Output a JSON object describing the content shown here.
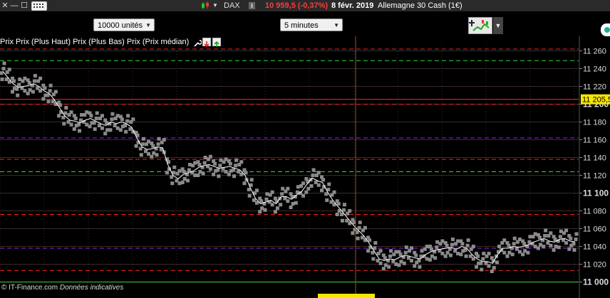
{
  "titlebar": {
    "close_glyph": "✕",
    "minimize_glyph": "—",
    "maximize_glyph": "☐",
    "keyboard_icon": "keyboard-icon",
    "candlestick_icon": "candlestick-icon",
    "symbol": "DAX",
    "info_glyph": "i",
    "price_change": "10 959,5 (-0,37%)",
    "date": "8 févr. 2019",
    "instrument": "Allemagne 30 Cash (1€)"
  },
  "toolbar": {
    "units_value": "10000 unités",
    "interval_value": "5 minutes",
    "indicator_icon": "indicators-icon"
  },
  "legend": {
    "text": "Prix Prix (Plus Haut) Prix (Plus Bas) Prix (Prix médian)",
    "wrench_icon": "wrench-icon",
    "down_icon": "arrow-down-icon",
    "up_icon": "arrow-up-icon"
  },
  "colors": {
    "background": "#000000",
    "grid": "#3a2a2a",
    "price_dots": "#8a8a8a",
    "median_line": "#ffffff",
    "level_red": "#ff2020",
    "level_green": "#3cd43c",
    "level_purple": "#a020f0",
    "current_price_bg": "#f5e600"
  },
  "footer": {
    "copyright": "© IT-Finance.com",
    "disclaimer": "Données indicatives"
  },
  "chart_data": {
    "type": "scatter",
    "y_ticks": [
      "11 260",
      "11 240",
      "11 220",
      "11 200",
      "11 180",
      "11 160",
      "11 140",
      "11 120",
      "11 100",
      "11 080",
      "11 060",
      "11 040",
      "11 020",
      "11 000"
    ],
    "bold_ticks": [
      "11 200",
      "11 100",
      "11 000"
    ],
    "ylim": [
      10998,
      11266
    ],
    "current_price_label": "11 205,5",
    "current_price": 11205.5,
    "horizontal_levels": [
      {
        "y": 11262,
        "color": "red",
        "style": "dashed"
      },
      {
        "y": 11249,
        "color": "green",
        "style": "dashed"
      },
      {
        "y": 11205.5,
        "color": "red",
        "style": "solid"
      },
      {
        "y": 11200,
        "color": "red",
        "style": "dashed"
      },
      {
        "y": 11162,
        "color": "purple",
        "style": "dashed"
      },
      {
        "y": 11138,
        "color": "red",
        "style": "dashed"
      },
      {
        "y": 11124,
        "color": "green",
        "style": "dashed"
      },
      {
        "y": 11076,
        "color": "red",
        "style": "dashed"
      },
      {
        "y": 11038,
        "color": "purple",
        "style": "dashed"
      },
      {
        "y": 11013,
        "color": "red",
        "style": "dashed"
      },
      {
        "y": 11000,
        "color": "green",
        "style": "solid"
      }
    ],
    "median": [
      11237,
      11230,
      11223,
      11219,
      11220,
      11221,
      11223,
      11220,
      11215,
      11212,
      11205,
      11196,
      11187,
      11182,
      11181,
      11179,
      11182,
      11184,
      11181,
      11178,
      11176,
      11180,
      11178,
      11180,
      11178,
      11174,
      11162,
      11152,
      11149,
      11150,
      11152,
      11151,
      11132,
      11120,
      11116,
      11121,
      11123,
      11125,
      11129,
      11131,
      11132,
      11130,
      11128,
      11129,
      11130,
      11128,
      11126,
      11120,
      11106,
      11094,
      11088,
      11090,
      11092,
      11088,
      11096,
      11096,
      11093,
      11098,
      11102,
      11110,
      11117,
      11114,
      11112,
      11101,
      11092,
      11085,
      11078,
      11071,
      11064,
      11058,
      11052,
      11044,
      11035,
      11026,
      11024,
      11026,
      11025,
      11028,
      11030,
      11029,
      11027,
      11026,
      11031,
      11034,
      11036,
      11037,
      11038,
      11039,
      11037,
      11040,
      11038,
      11031,
      11026,
      11023,
      11023,
      11021,
      11031,
      11038,
      11038,
      11040,
      11039,
      11040,
      11042,
      11045,
      11047,
      11049,
      11046,
      11045,
      11048,
      11049,
      11046,
      11045
    ]
  }
}
